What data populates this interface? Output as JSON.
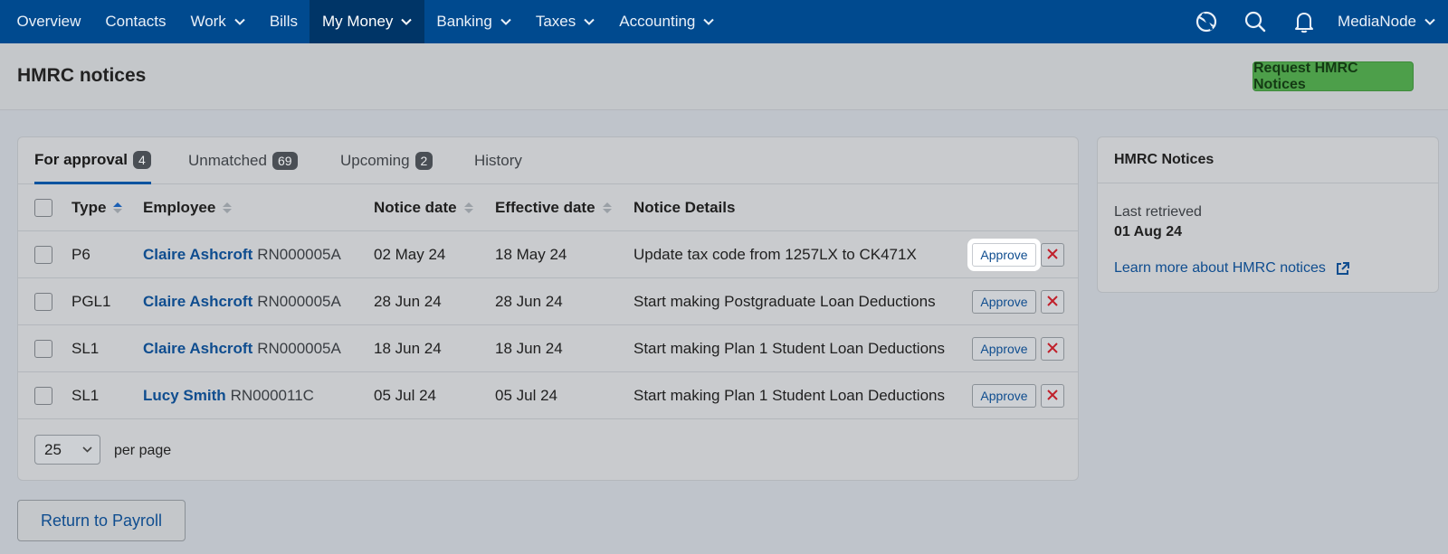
{
  "nav": {
    "items": [
      {
        "label": "Overview",
        "dropdown": false,
        "active": false
      },
      {
        "label": "Contacts",
        "dropdown": false,
        "active": false
      },
      {
        "label": "Work",
        "dropdown": true,
        "active": false
      },
      {
        "label": "Bills",
        "dropdown": false,
        "active": false
      },
      {
        "label": "My Money",
        "dropdown": true,
        "active": true
      },
      {
        "label": "Banking",
        "dropdown": true,
        "active": false
      },
      {
        "label": "Taxes",
        "dropdown": true,
        "active": false
      },
      {
        "label": "Accounting",
        "dropdown": true,
        "active": false
      }
    ],
    "icons": [
      "spark-icon",
      "search-icon",
      "bell-icon"
    ],
    "account_label": "MediaNode"
  },
  "header": {
    "title": "HMRC notices",
    "request_button": "Request HMRC Notices"
  },
  "tabs": [
    {
      "label": "For approval",
      "count": "4",
      "active": true
    },
    {
      "label": "Unmatched",
      "count": "69",
      "active": false
    },
    {
      "label": "Upcoming",
      "count": "2",
      "active": false
    },
    {
      "label": "History",
      "count": null,
      "active": false
    }
  ],
  "table": {
    "columns": {
      "type": "Type",
      "employee": "Employee",
      "notice_date": "Notice date",
      "effective_date": "Effective date",
      "details": "Notice Details"
    },
    "rows": [
      {
        "type": "P6",
        "employee_name": "Claire Ashcroft",
        "employee_ref": "RN000005A",
        "notice_date": "02 May 24",
        "effective_date": "18 May 24",
        "details": "Update tax code from 1257LX to CK471X",
        "approve": "Approve",
        "highlighted": true
      },
      {
        "type": "PGL1",
        "employee_name": "Claire Ashcroft",
        "employee_ref": "RN000005A",
        "notice_date": "28 Jun 24",
        "effective_date": "28 Jun 24",
        "details": "Start making Postgraduate Loan Deductions",
        "approve": "Approve",
        "highlighted": false
      },
      {
        "type": "SL1",
        "employee_name": "Claire Ashcroft",
        "employee_ref": "RN000005A",
        "notice_date": "18 Jun 24",
        "effective_date": "18 Jun 24",
        "details": "Start making Plan 1 Student Loan Deductions",
        "approve": "Approve",
        "highlighted": false
      },
      {
        "type": "SL1",
        "employee_name": "Lucy Smith",
        "employee_ref": "RN000011C",
        "notice_date": "05 Jul 24",
        "effective_date": "05 Jul 24",
        "details": "Start making Plan 1 Student Loan Deductions",
        "approve": "Approve",
        "highlighted": false
      }
    ],
    "per_page_value": "25",
    "per_page_label": "per page"
  },
  "side": {
    "title": "HMRC Notices",
    "last_retrieved_label": "Last retrieved",
    "last_retrieved_value": "01 Aug 24",
    "learn_more": "Learn more about HMRC notices"
  },
  "return_button": "Return to Payroll",
  "colors": {
    "nav_bg": "#004a8f",
    "nav_active_bg": "#003567",
    "link": "#0f4d8f",
    "request_button_bg": "#4d9f4a",
    "reject_icon": "#c0202b"
  }
}
